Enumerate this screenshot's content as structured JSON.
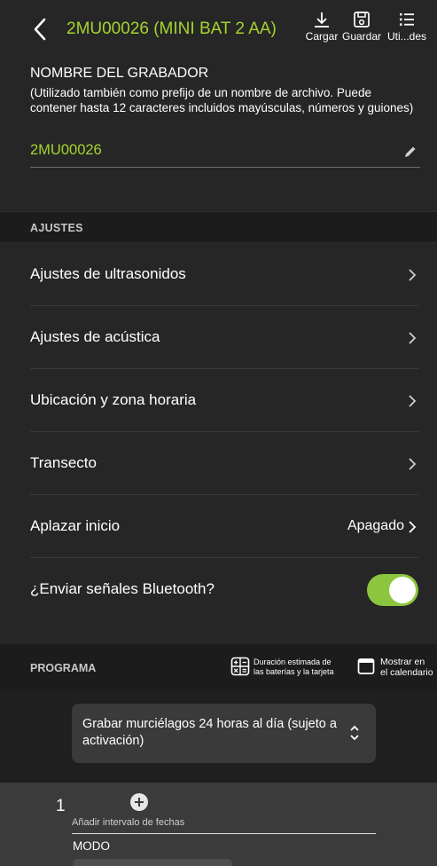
{
  "header": {
    "title": "2MU00026 (MINI BAT 2 AA)",
    "tools": {
      "cargar": "Cargar",
      "guardar": "Guardar",
      "utilidades": "Uti...des"
    }
  },
  "name_section": {
    "title": "NOMBRE DEL GRABADOR",
    "help": "(Utilizado también como prefijo de un nombre de archivo. Puede contener hasta 12 caracteres incluidos mayúsculas, números y guiones)",
    "value": "2MU00026"
  },
  "settings": {
    "header": "AJUSTES",
    "rows": [
      {
        "label": "Ajustes de ultrasonidos"
      },
      {
        "label": "Ajustes de acústica"
      },
      {
        "label": "Ubicación y zona horaria"
      },
      {
        "label": "Transecto"
      },
      {
        "label": "Aplazar inicio",
        "value": "Apagado"
      },
      {
        "label": "¿Enviar señales Bluetooth?",
        "toggle_on": true
      }
    ]
  },
  "program": {
    "header": "PROGRAMA",
    "duration_label_1": "Duración estimada de",
    "duration_label_2": "las baterías y la tarjeta",
    "calendar_label_1": "Mostrar en",
    "calendar_label_2": "el calendario",
    "selected_option": "Grabar murciélagos 24 horas al día (sujeto a activación)"
  },
  "interval": {
    "number": "1",
    "add_label": "Añadir intervalo de fechas",
    "mode_label": "MODO"
  },
  "colors": {
    "accent": "#a4d42e",
    "toggle": "#8cc63f",
    "background": "#1f1f1f"
  }
}
